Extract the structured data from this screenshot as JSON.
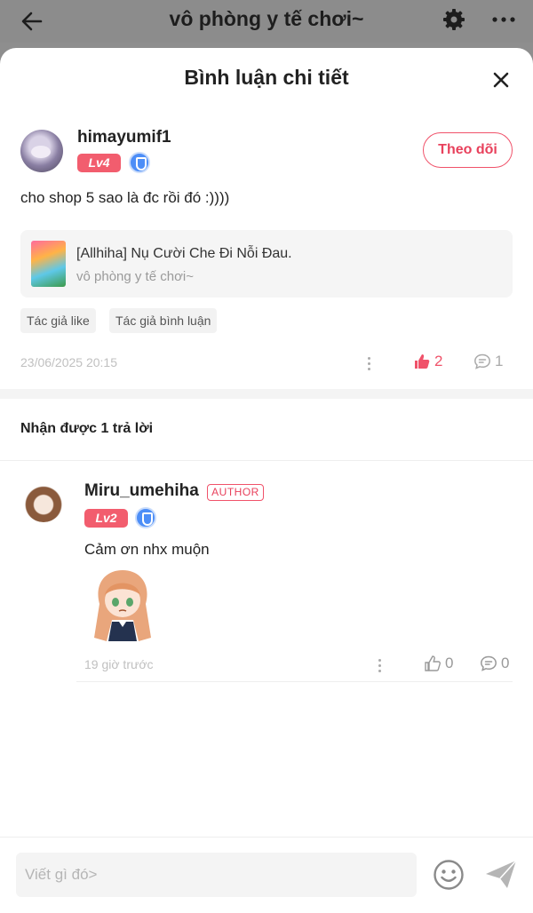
{
  "topbar": {
    "title": "vô phòng y tế chơi~",
    "back_icon": "arrow-left-icon",
    "settings_icon": "gear-icon",
    "more_icon": "more-horizontal-icon"
  },
  "sheet": {
    "title": "Bình luận chi tiết",
    "close_icon": "close-icon"
  },
  "comment": {
    "username": "himayumif1",
    "level": "Lv4",
    "follow_label": "Theo dõi",
    "text": "cho shop 5 sao là đc rồi đó :))))",
    "source": {
      "title": "[Allhiha] Nụ Cười Che Đi Nỗi Đau.",
      "subtitle": "vô phòng y tế chơi~"
    },
    "tags": [
      "Tác giả like",
      "Tác giả bình luận"
    ],
    "timestamp": "23/06/2025 20:15",
    "likes": "2",
    "replies": "1",
    "liked": true
  },
  "replies_section": {
    "heading": "Nhận được 1 trả lời"
  },
  "reply": {
    "username": "Miru_umehiha",
    "author_badge": "AUTHOR",
    "level": "Lv2",
    "text": "Cảm ơn nhx muộn",
    "time": "19 giờ trước",
    "likes": "0",
    "comments": "0"
  },
  "composer": {
    "placeholder": "Viết gì đó>",
    "emoji_icon": "smiley-icon",
    "send_icon": "send-icon"
  },
  "colors": {
    "accent": "#f0526a",
    "level_badge": "#f25d6e",
    "shield": "#4d8ef7",
    "muted": "#c0c0c0"
  }
}
